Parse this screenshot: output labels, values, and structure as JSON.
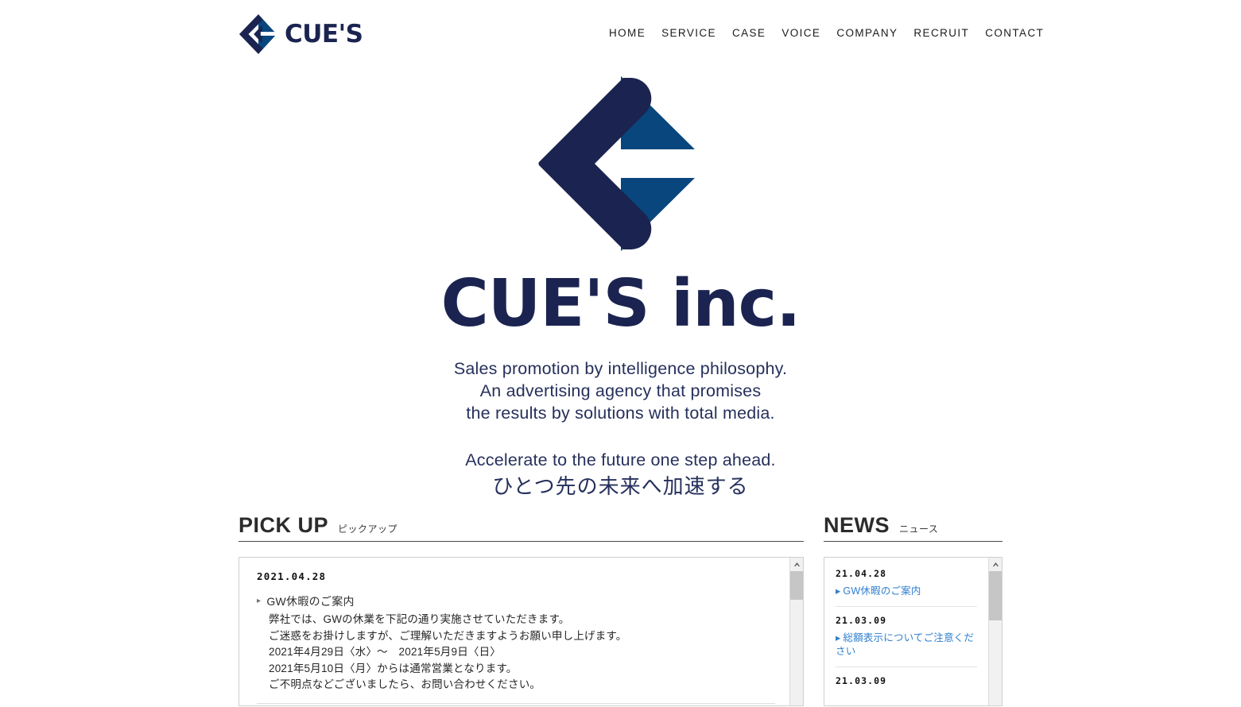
{
  "colors": {
    "navy": "#1b2450",
    "blue": "#08467d",
    "link_blue": "#2f7fd0",
    "rule": "#4a4a4a",
    "panel_border": "#cfcfcf"
  },
  "header": {
    "logo_text": "CUE'S",
    "logo_icon": "cues-diamond-logo",
    "nav": [
      {
        "label": "HOME",
        "name": "nav-item-home"
      },
      {
        "label": "SERVICE",
        "name": "nav-item-service"
      },
      {
        "label": "CASE",
        "name": "nav-item-case"
      },
      {
        "label": "VOICE",
        "name": "nav-item-voice"
      },
      {
        "label": "COMPANY",
        "name": "nav-item-company"
      },
      {
        "label": "RECRUIT",
        "name": "nav-item-recruit"
      },
      {
        "label": "CONTACT",
        "name": "nav-item-contact"
      }
    ]
  },
  "hero": {
    "logo_icon": "cues-diamond-logo-large",
    "title": "CUE'S inc.",
    "tagline_line1": "Sales promotion by intelligence philosophy.",
    "tagline_line2": "An advertising agency that promises",
    "tagline_line3": "the results by solutions with total media.",
    "catch_en": "Accelerate to the future one step ahead.",
    "catch_jp": "ひとつ先の未来へ加速する"
  },
  "pickup": {
    "heading": "PICK UP",
    "heading_sub": "ピックアップ",
    "scrollbar_up_icon": "chevron-up-icon",
    "items": [
      {
        "date": "2021.04.28",
        "title": "GW休暇のご案内",
        "bullet_icon": "triangle-right-icon",
        "lines": [
          "弊社では、GWの休業を下記の通り実施させていただきます。",
          "ご迷惑をお掛けしますが、ご理解いただきますようお願い申し上げます。",
          "2021年4月29日〈水〉〜　2021年5月9日〈日〉",
          "2021年5月10日〈月〉からは通常営業となります。",
          "ご不明点などございましたら、お問い合わせください。"
        ]
      }
    ]
  },
  "news": {
    "heading": "NEWS",
    "heading_sub": "ニュース",
    "scrollbar_up_icon": "chevron-up-icon",
    "items": [
      {
        "date": "21.04.28",
        "link": "GW休暇のご案内",
        "bullet_icon": "triangle-right-icon"
      },
      {
        "date": "21.03.09",
        "link": "総額表示についてご注意ください",
        "bullet_icon": "triangle-right-icon"
      },
      {
        "date": "21.03.09",
        "link": "",
        "bullet_icon": "triangle-right-icon"
      }
    ]
  }
}
